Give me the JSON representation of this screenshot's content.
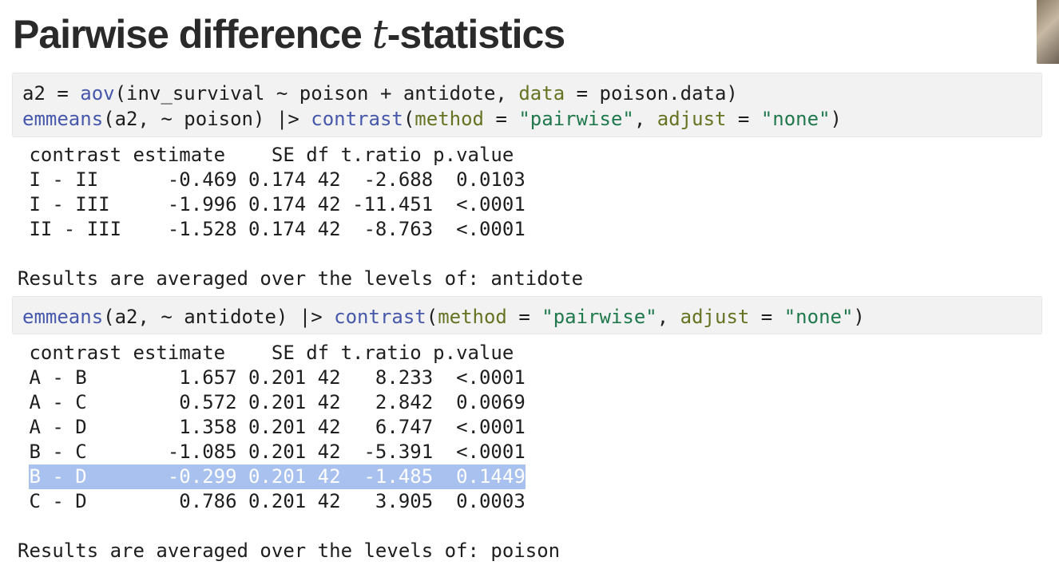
{
  "slide": {
    "title_prefix": "Pairwise difference ",
    "title_var": "t",
    "title_suffix": "-statistics"
  },
  "code1": {
    "line1": {
      "lhs": "a2 = ",
      "fn": "aov",
      "open": "(inv_survival ~ poison + antidote, ",
      "arg": "data",
      "rest": " = poison.data)"
    },
    "line2": {
      "fn1": "emmeans",
      "mid": "(a2, ~ poison) |> ",
      "fn2": "contrast",
      "open": "(",
      "arg1": "method",
      "eq1": " = ",
      "str1": "\"pairwise\"",
      "comma": ", ",
      "arg2": "adjust",
      "eq2": " = ",
      "str2": "\"none\"",
      "close": ")"
    }
  },
  "output1": {
    "header": " contrast estimate    SE df t.ratio p.value",
    "rows": [
      " I - II      -0.469 0.174 42  -2.688  0.0103",
      " I - III     -1.996 0.174 42 -11.451  <.0001",
      " II - III    -1.528 0.174 42  -8.763  <.0001"
    ],
    "note": "Results are averaged over the levels of: antidote"
  },
  "code2": {
    "fn1": "emmeans",
    "mid": "(a2, ~ antidote) |> ",
    "fn2": "contrast",
    "open": "(",
    "arg1": "method",
    "eq1": " = ",
    "str1": "\"pairwise\"",
    "comma": ", ",
    "arg2": "adjust",
    "eq2": " = ",
    "str2": "\"none\"",
    "close": ")"
  },
  "output2": {
    "header": " contrast estimate    SE df t.ratio p.value",
    "rows": [
      " A - B        1.657 0.201 42   8.233  <.0001",
      " A - C        0.572 0.201 42   2.842  0.0069",
      " A - D        1.358 0.201 42   6.747  <.0001",
      " B - C       -1.085 0.201 42  -5.391  <.0001"
    ],
    "highlighted_row": "B - D       -0.299 0.201 42  -1.485  0.1449",
    "last_row": " C - D        0.786 0.201 42   3.905  0.0003",
    "note": "Results are averaged over the levels of: poison"
  },
  "colors": {
    "function": "#4758ab",
    "argument": "#657422",
    "string": "#20794d",
    "highlight": "#a9c1ee"
  }
}
